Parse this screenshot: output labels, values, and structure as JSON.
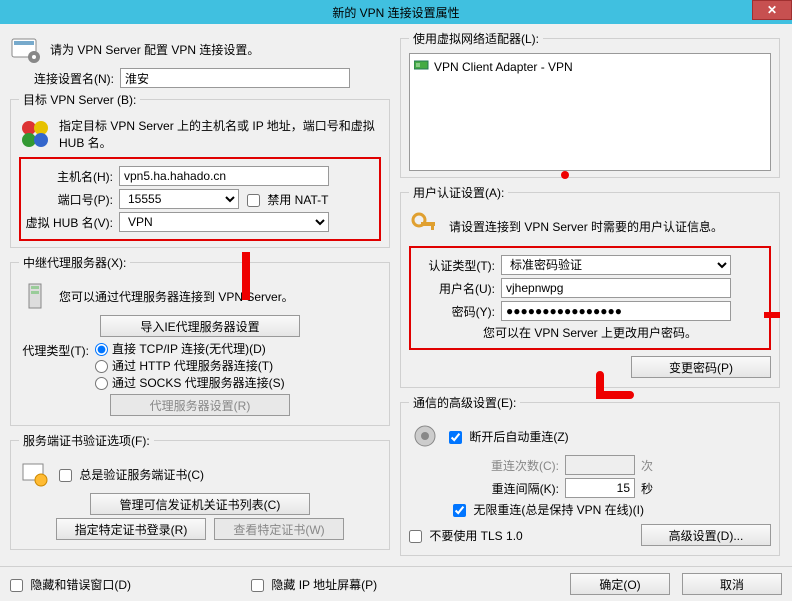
{
  "title": "新的 VPN 连接设置属性",
  "intro": "请为 VPN Server 配置 VPN 连接设置。",
  "conn_name_label": "连接设置名(N):",
  "conn_name": "淮安",
  "target_legend": "目标 VPN Server (B):",
  "target_desc": "指定目标 VPN Server 上的主机名或 IP 地址，端口号和虚拟 HUB 名。",
  "host_label": "主机名(H):",
  "host": "vpn5.ha.hahado.cn",
  "port_label": "端口号(P):",
  "port": "15555",
  "nat_t_label": "禁用 NAT-T",
  "hub_label": "虚拟 HUB 名(V):",
  "hub": "VPN",
  "relay_legend": "中继代理服务器(X):",
  "relay_desc": "您可以通过代理服务器连接到 VPN Server。",
  "import_ie_btn": "导入IE代理服务器设置",
  "proxy_type_label": "代理类型(T):",
  "proxy_direct": "直接 TCP/IP 连接(无代理)(D)",
  "proxy_http": "通过 HTTP 代理服务器连接(T)",
  "proxy_socks": "通过 SOCKS 代理服务器连接(S)",
  "proxy_settings_btn": "代理服务器设置(R)",
  "ssl_legend": "服务端证书验证选项(F):",
  "ssl_always_verify": "总是验证服务端证书(C)",
  "ssl_manage_ca_btn": "管理可信发证机关证书列表(C)",
  "ssl_register_cert_btn": "指定特定证书登录(R)",
  "ssl_view_cert_btn": "查看特定证书(W)",
  "hide_error_chk": "隐藏和错误窗口(D)",
  "hide_ip_chk": "隐藏 IP 地址屏幕(P)",
  "adapter_legend": "使用虚拟网络适配器(L):",
  "adapter_item": "VPN Client Adapter - VPN",
  "auth_legend": "用户认证设置(A):",
  "auth_desc": "请设置连接到 VPN Server 时需要的用户认证信息。",
  "auth_type_label": "认证类型(T):",
  "auth_type": "标准密码验证",
  "user_label": "用户名(U):",
  "user": "vjhepnwpg",
  "pass_label": "密码(Y):",
  "pass": "●●●●●●●●●●●●●●●●",
  "pass_hint": "您可以在 VPN Server 上更改用户密码。",
  "change_pass_btn": "变更密码(P)",
  "adv_legend": "通信的高级设置(E):",
  "adv_auto_reconnect": "断开后自动重连(Z)",
  "adv_retry_count_label": "重连次数(C):",
  "adv_retry_count_suffix": "次",
  "adv_retry_interval_label": "重连间隔(K):",
  "adv_retry_interval": "15",
  "adv_retry_interval_suffix": "秒",
  "adv_infinite": "无限重连(总是保持 VPN 在线)(I)",
  "adv_no_tls10": "不要使用 TLS 1.0",
  "adv_more_btn": "高级设置(D)...",
  "ok_btn": "确定(O)",
  "cancel_btn": "取消"
}
